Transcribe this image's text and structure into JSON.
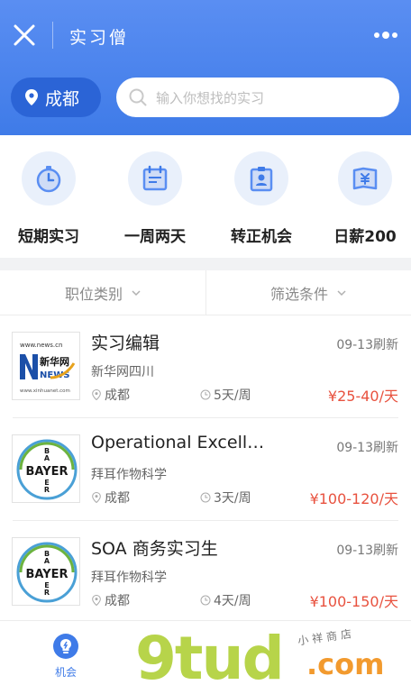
{
  "header": {
    "title": "实习僧",
    "city": "成都",
    "search_placeholder": "输入你想找的实习"
  },
  "categories": [
    {
      "label": "短期实习",
      "icon": "stopwatch-icon"
    },
    {
      "label": "一周两天",
      "icon": "calendar-icon"
    },
    {
      "label": "转正机会",
      "icon": "badge-icon"
    },
    {
      "label": "日薪200",
      "icon": "money-icon"
    }
  ],
  "filters": {
    "category": "职位类别",
    "conditions": "筛选条件"
  },
  "jobs": [
    {
      "title": "实习编辑",
      "date": "09-13刷新",
      "company": "新华网四川",
      "location": "成都",
      "days": "5天/周",
      "salary": "¥25-40/天",
      "logo": "xinhua"
    },
    {
      "title": "Operational Excell…",
      "date": "09-13刷新",
      "company": "拜耳作物科学",
      "location": "成都",
      "days": "3天/周",
      "salary": "¥100-120/天",
      "logo": "bayer"
    },
    {
      "title": "SOA 商务实习生",
      "date": "09-13刷新",
      "company": "拜耳作物科学",
      "location": "成都",
      "days": "4天/周",
      "salary": "¥100-150/天",
      "logo": "bayer"
    }
  ],
  "logos": {
    "xinhua": {
      "url": "www.news.cn",
      "name": "新华网",
      "sub": "NEWS",
      "url2": "www.xinhuanet.com"
    },
    "bayer": {
      "text": "BAYER"
    }
  },
  "tabbar": {
    "home_label": "机会"
  },
  "watermark": {
    "main": "9tud",
    "suffix": ".com",
    "tagline": "小祥商店"
  },
  "colors": {
    "primary": "#3f7be8",
    "salary": "#e8523f"
  }
}
